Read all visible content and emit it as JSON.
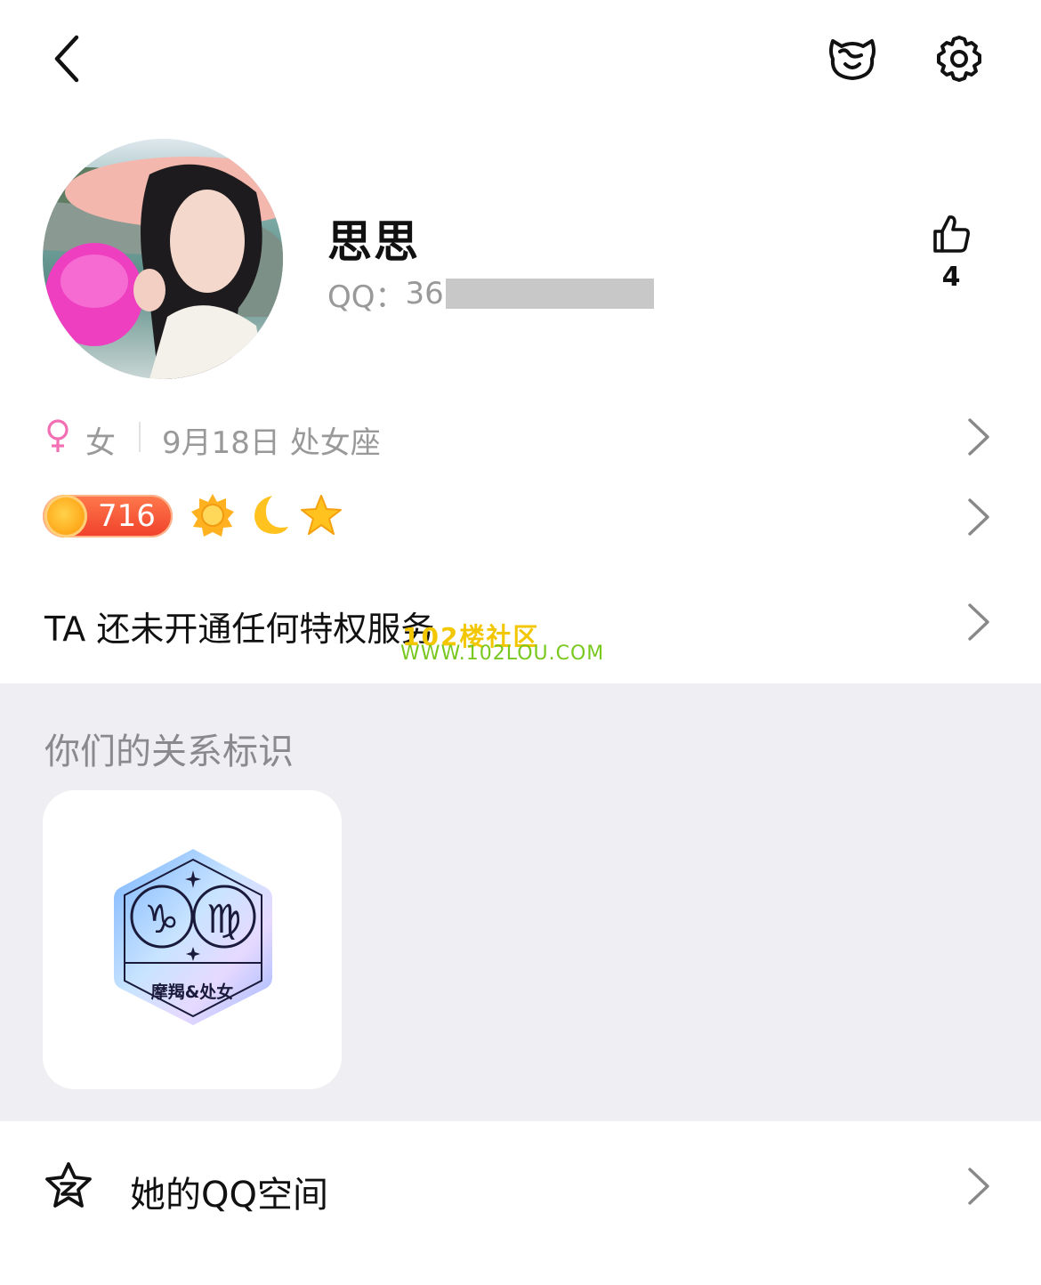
{
  "header": {
    "back_icon": "chevron-left-icon",
    "pet_icon": "pet-face-icon",
    "settings_icon": "gear-icon"
  },
  "profile": {
    "nickname": "思思",
    "qq_label": "QQ：",
    "qq_visible_prefix": "36",
    "likes_count": "4"
  },
  "info": {
    "gender_symbol": "♀",
    "gender": "女",
    "birthday": "9月18日 处女座"
  },
  "level": {
    "value": "716",
    "icons": [
      "sun-icon",
      "moon-icon",
      "star-icon"
    ]
  },
  "privilege": {
    "text": "TA 还未开通任何特权服务"
  },
  "watermark": {
    "name": "102楼社区",
    "url": "WWW.102LOU.COM"
  },
  "relationship": {
    "title": "你们的关系标识",
    "badge_label": "摩羯&处女",
    "sign_left": "♑",
    "sign_right": "♍"
  },
  "qzone": {
    "label": "她的QQ空间"
  },
  "colors": {
    "accent_pink": "#f26fb4",
    "level_orange": "#f0402a",
    "section_bg": "#efeff3",
    "muted_text": "#999999"
  }
}
